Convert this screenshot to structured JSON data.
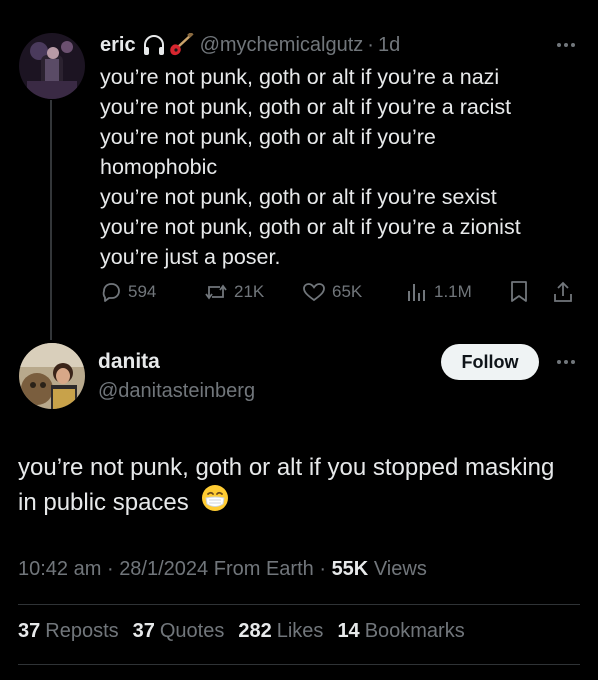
{
  "quoted_tweet": {
    "author_name": "eric",
    "icons": [
      "headphones-icon",
      "guitar-icon"
    ],
    "handle": "@mychemicalgutz",
    "separator": "·",
    "time": "1d",
    "lines": [
      "you’re not punk, goth or alt if you’re a nazi",
      "you’re not punk, goth or alt if you’re a racist",
      "you’re not punk, goth or alt if you’re",
      "homophobic",
      "you’re not punk, goth or alt if you’re sexist",
      "you’re not punk, goth or alt if you’re a zionist",
      "you’re just a poser."
    ],
    "actions": {
      "replies": "594",
      "reposts": "21K",
      "likes": "65K",
      "views": "1.1M"
    }
  },
  "main_tweet": {
    "author_name": "danita",
    "handle": "@danitasteinberg",
    "follow_label": "Follow",
    "text": "you’re not punk, goth or alt if you stopped masking in public spaces",
    "emoji": "face-with-medical-mask-icon",
    "time": "10:42 am",
    "sep": "·",
    "date": "28/1/2024",
    "source": "From Earth",
    "views_count": "55K",
    "views_label": "Views",
    "stats": [
      {
        "count": "37",
        "label": "Reposts"
      },
      {
        "count": "37",
        "label": "Quotes"
      },
      {
        "count": "282",
        "label": "Likes"
      },
      {
        "count": "14",
        "label": "Bookmarks"
      }
    ]
  },
  "colors": {
    "background": "#000000",
    "text": "#e7e9ea",
    "muted": "#71767b",
    "follow_bg": "#eff3f4"
  }
}
